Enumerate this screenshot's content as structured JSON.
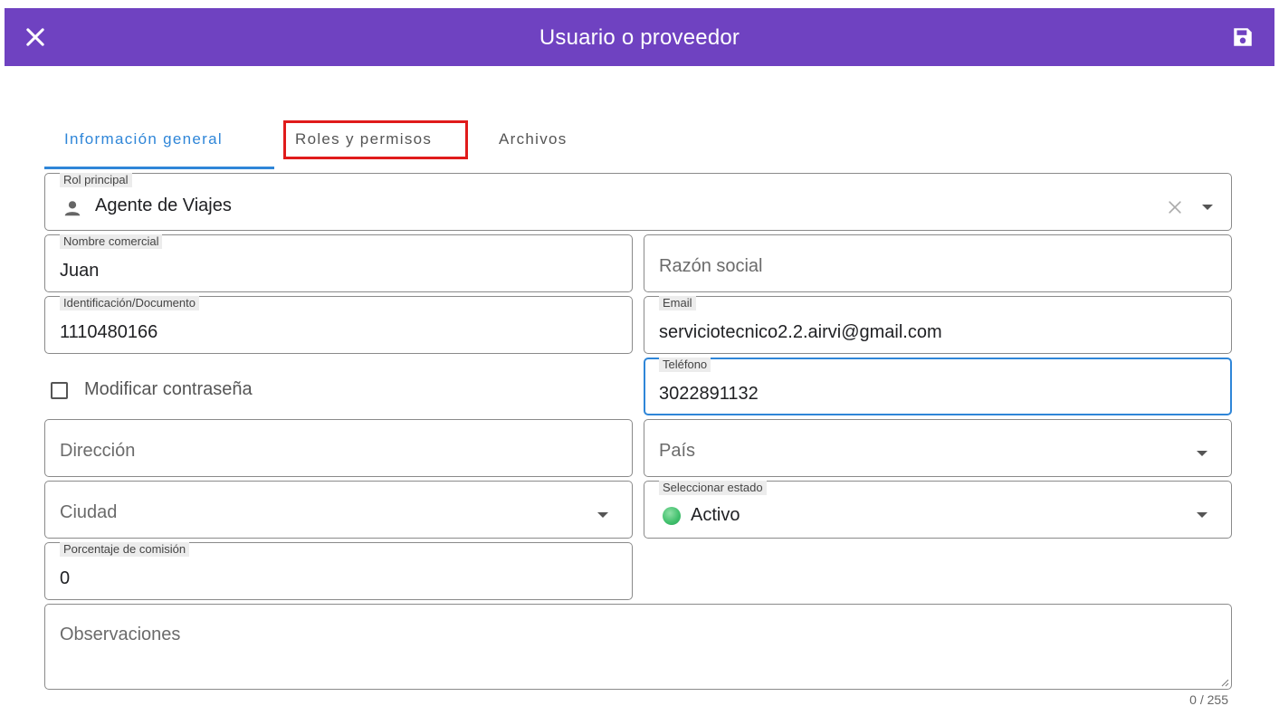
{
  "header": {
    "title": "Usuario o proveedor",
    "close_icon": "close-icon",
    "save_icon": "save-icon",
    "background": "#6f42c1"
  },
  "tabs": [
    {
      "label": "Información general",
      "active": true
    },
    {
      "label": "Roles y permisos",
      "active": false,
      "highlighted": true
    },
    {
      "label": "Archivos",
      "active": false
    }
  ],
  "form": {
    "rol_principal": {
      "label": "Rol principal",
      "value": "Agente de Viajes",
      "icon": "person-icon"
    },
    "nombre_comercial": {
      "label": "Nombre comercial",
      "value": "Juan"
    },
    "razon_social": {
      "placeholder": "Razón social"
    },
    "identificacion": {
      "label": "Identificación/Documento",
      "value": "1110480166"
    },
    "email": {
      "label": "Email",
      "value": "serviciotecnico2.2.airvi@gmail.com"
    },
    "modificar_contrasena": {
      "label": "Modificar contraseña",
      "checked": false
    },
    "telefono": {
      "label": "Teléfono",
      "value": "3022891132"
    },
    "direccion": {
      "placeholder": "Dirección"
    },
    "pais": {
      "placeholder": "País"
    },
    "ciudad": {
      "placeholder": "Ciudad"
    },
    "estado": {
      "label": "Seleccionar estado",
      "value": "Activo",
      "status_color": "#3fbf6b"
    },
    "porcentaje_comision": {
      "label": "Porcentaje de comisión",
      "value": "0"
    },
    "observaciones": {
      "placeholder": "Observaciones",
      "counter": "0 / 255"
    }
  },
  "colors": {
    "accent": "#2f86d8",
    "highlight_border": "#e01b1b"
  }
}
